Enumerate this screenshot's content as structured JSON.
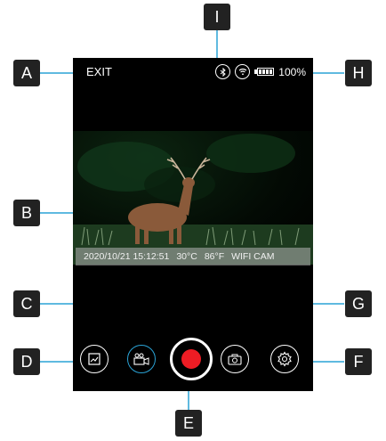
{
  "screen": {
    "exit_label": "EXIT",
    "battery_percent": "100%",
    "status_icons": [
      "bluetooth-icon",
      "wifi-icon",
      "battery-icon"
    ],
    "caption": {
      "datetime": "2020/10/21 15:12:51",
      "temp_c": "30°C",
      "temp_f": "86°F",
      "camera_name": "WIFI CAM"
    },
    "controls": [
      "gallery-icon",
      "video-camera-icon",
      "record-button",
      "photo-camera-icon",
      "settings-icon"
    ],
    "accent_color": "#2aa3d6",
    "record_color": "#ee1c24"
  },
  "callouts": {
    "A": "A",
    "B": "B",
    "C": "C",
    "D": "D",
    "E": "E",
    "F": "F",
    "G": "G",
    "H": "H",
    "I": "I"
  }
}
